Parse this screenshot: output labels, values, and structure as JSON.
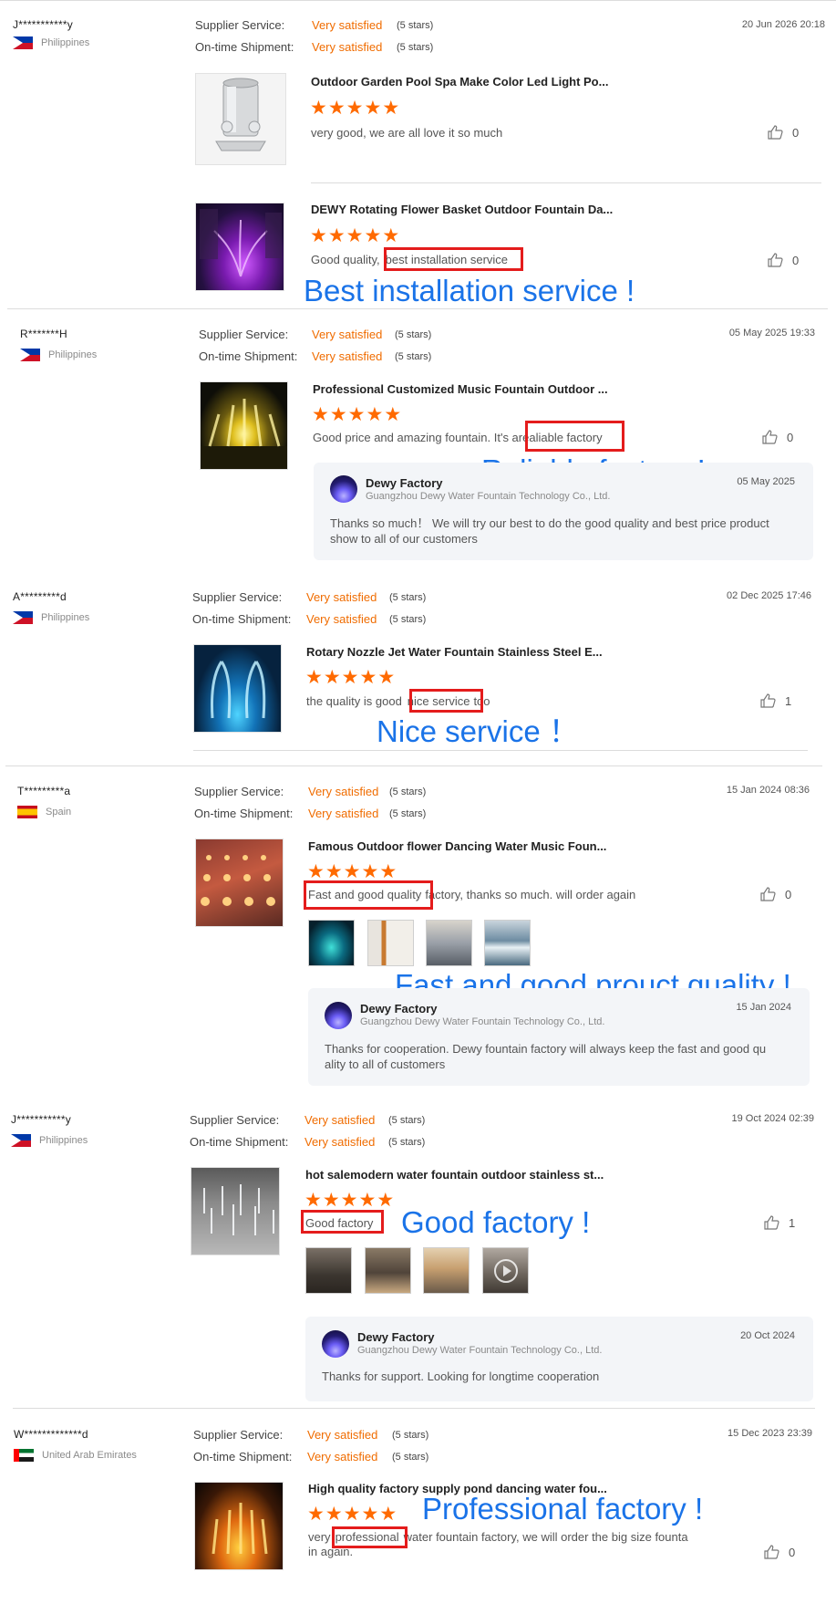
{
  "labels": {
    "supplier_service": "Supplier Service:",
    "on_time_shipment": "On-time Shipment:",
    "very_satisfied": "Very satisfied",
    "five_stars": "(5 stars)"
  },
  "reviews": [
    {
      "user": "J***********y",
      "country": "Philippines",
      "date": "20 Jun 2026 20:18",
      "products": [
        {
          "title": "Outdoor Garden Pool Spa Make Color Led Light Po...",
          "rating": 5,
          "text": "very good, we are all love it so much",
          "likes": "0"
        },
        {
          "title": "DEWY Rotating Flower Basket Outdoor Fountain Da...",
          "rating": 5,
          "text_prefix": "Good quality,",
          "text_highlight": "best installation service",
          "likes": "0",
          "callout": "Best installation service !"
        }
      ]
    },
    {
      "user": "R*******H",
      "country": "Philippines",
      "date": "05 May 2025 19:33",
      "product": {
        "title": "Professional Customized Music Fountain Outdoor ...",
        "rating": 5,
        "text_prefix": "Good price and amazing fountain. It's a",
        "text_highlight": "realiable factory",
        "likes": "0",
        "callout": "Reliable factory !"
      },
      "reply": {
        "name": "Dewy Factory",
        "company": "Guangzhou Dewy Water Fountain Technology Co., Ltd.",
        "date": "05 May 2025",
        "lines": [
          "Thanks so much！ We will try our best to do the good quality and best price product",
          "show to all of our customers"
        ]
      }
    },
    {
      "user": "A*********d",
      "country": "Philippines",
      "date": "02 Dec 2025 17:46",
      "product": {
        "title": "Rotary Nozzle Jet Water Fountain Stainless Steel E...",
        "rating": 5,
        "text_prefix": "the quality is good",
        "text_highlight": "nice service",
        "text_suffix": "too",
        "likes": "1",
        "callout": "Nice service ！"
      }
    },
    {
      "user": "T*********a",
      "country": "Spain",
      "date": "15 Jan 2024 08:36",
      "product": {
        "title": "Famous Outdoor flower Dancing Water Music Foun...",
        "rating": 5,
        "text_highlight": "Fast and good quality",
        "text_suffix": "factory, thanks so much. will order again",
        "likes": "0",
        "callout": "Fast and good prouct quality !"
      },
      "reply": {
        "name": "Dewy Factory",
        "company": "Guangzhou Dewy Water Fountain Technology Co., Ltd.",
        "date": "15 Jan 2024",
        "lines": [
          "Thanks for cooperation. Dewy fountain factory will always keep the fast and good qu",
          "ality to all of customers"
        ]
      }
    },
    {
      "user": "J***********y",
      "country": "Philippines",
      "date": "19 Oct 2024 02:39",
      "product": {
        "title": "hot salemodern water fountain outdoor stainless st...",
        "rating": 5,
        "text_highlight": "Good factory",
        "likes": "1",
        "callout": "Good factory !"
      },
      "reply": {
        "name": "Dewy Factory",
        "company": "Guangzhou Dewy Water Fountain Technology Co., Ltd.",
        "date": "20 Oct 2024",
        "lines": [
          "Thanks for support. Looking for longtime cooperation"
        ]
      }
    },
    {
      "user": "W*************d",
      "country": "United Arab Emirates",
      "date": "15 Dec 2023 23:39",
      "product": {
        "title": "High quality factory supply pond dancing water fou...",
        "rating": 5,
        "text_prefix": "very",
        "text_highlight": "professional",
        "text_suffix": "water fountain factory, we will order the big size founta",
        "text_line2": "in again.",
        "likes": "0",
        "callout": "Professional factory !"
      }
    }
  ],
  "icons": {
    "star": "star-icon",
    "like": "thumbs-up-icon",
    "video": "play-icon"
  },
  "colors": {
    "satisfied": "#f06c00",
    "stars": "#ff6a00",
    "highlight_box": "#e41c1c",
    "callout": "#1a73e8"
  }
}
